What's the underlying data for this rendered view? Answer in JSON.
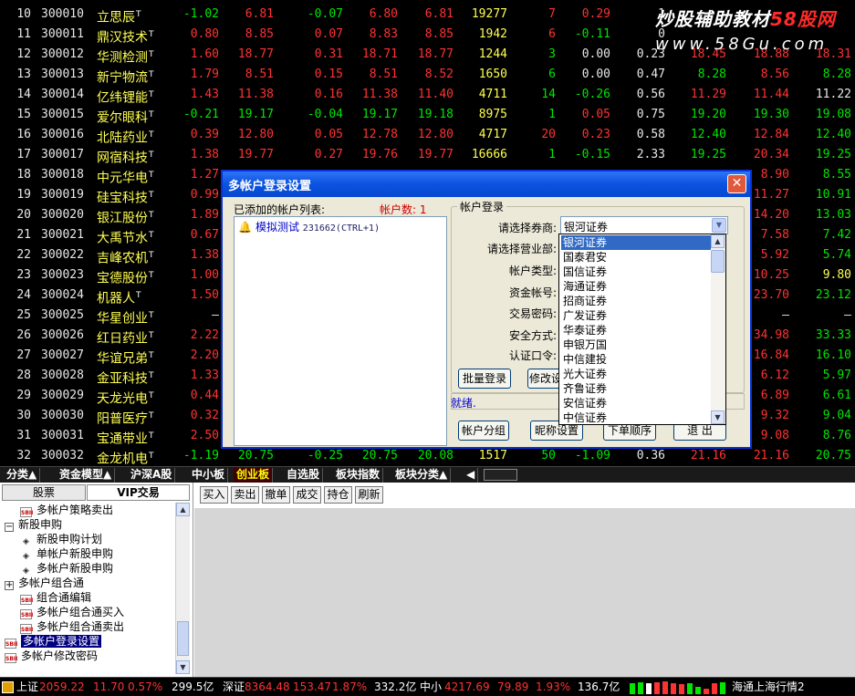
{
  "stock_rows": [
    {
      "idx": "10",
      "code": "300010",
      "name": "立思辰",
      "v": [
        "-1.02",
        "6.81",
        "-0.07",
        "6.80",
        "6.81",
        "19277",
        "7",
        "0.29",
        "1",
        "",
        "",
        ""
      ],
      "cls": [
        "green",
        "red",
        "green",
        "red",
        "red",
        "yellow",
        "red",
        "red",
        "white",
        "red",
        "red",
        "red"
      ]
    },
    {
      "idx": "11",
      "code": "300011",
      "name": "鼎汉技术",
      "v": [
        "0.80",
        "8.85",
        "0.07",
        "8.83",
        "8.85",
        "1942",
        "6",
        "-0.11",
        "0",
        "",
        "",
        ""
      ],
      "cls": [
        "red",
        "red",
        "red",
        "red",
        "red",
        "yellow",
        "red",
        "green",
        "white",
        "red",
        "red",
        "red"
      ]
    },
    {
      "idx": "12",
      "code": "300012",
      "name": "华测检测",
      "v": [
        "1.60",
        "18.77",
        "0.31",
        "18.71",
        "18.77",
        "1244",
        "3",
        "0.00",
        "0.23",
        "18.45",
        "18.88",
        "18.31"
      ],
      "cls": [
        "red",
        "red",
        "red",
        "red",
        "red",
        "yellow",
        "green",
        "white",
        "white",
        "red",
        "red",
        "red"
      ]
    },
    {
      "idx": "13",
      "code": "300013",
      "name": "新宁物流",
      "v": [
        "1.79",
        "8.51",
        "0.15",
        "8.51",
        "8.52",
        "1650",
        "6",
        "0.00",
        "0.47",
        "8.28",
        "8.56",
        "8.28"
      ],
      "cls": [
        "red",
        "red",
        "red",
        "red",
        "red",
        "yellow",
        "green",
        "white",
        "white",
        "green",
        "red",
        "green"
      ]
    },
    {
      "idx": "14",
      "code": "300014",
      "name": "亿纬锂能",
      "v": [
        "1.43",
        "11.38",
        "0.16",
        "11.38",
        "11.40",
        "4711",
        "14",
        "-0.26",
        "0.56",
        "11.29",
        "11.44",
        "11.22"
      ],
      "cls": [
        "red",
        "red",
        "red",
        "red",
        "red",
        "yellow",
        "green",
        "green",
        "white",
        "red",
        "red",
        "white"
      ]
    },
    {
      "idx": "15",
      "code": "300015",
      "name": "爱尔眼科",
      "v": [
        "-0.21",
        "19.17",
        "-0.04",
        "19.17",
        "19.18",
        "8975",
        "1",
        "0.05",
        "0.75",
        "19.20",
        "19.30",
        "19.08"
      ],
      "cls": [
        "green",
        "green",
        "green",
        "green",
        "green",
        "yellow",
        "green",
        "red",
        "white",
        "green",
        "green",
        "green"
      ]
    },
    {
      "idx": "16",
      "code": "300016",
      "name": "北陆药业",
      "v": [
        "0.39",
        "12.80",
        "0.05",
        "12.78",
        "12.80",
        "4717",
        "20",
        "0.23",
        "0.58",
        "12.40",
        "12.84",
        "12.40"
      ],
      "cls": [
        "red",
        "red",
        "red",
        "red",
        "red",
        "yellow",
        "red",
        "red",
        "white",
        "green",
        "red",
        "green"
      ]
    },
    {
      "idx": "17",
      "code": "300017",
      "name": "网宿科技",
      "v": [
        "1.38",
        "19.77",
        "0.27",
        "19.76",
        "19.77",
        "16666",
        "1",
        "-0.15",
        "2.33",
        "19.25",
        "20.34",
        "19.25"
      ],
      "cls": [
        "red",
        "red",
        "red",
        "red",
        "red",
        "yellow",
        "green",
        "green",
        "white",
        "green",
        "red",
        "green"
      ]
    },
    {
      "idx": "18",
      "code": "300018",
      "name": "中元华电",
      "v": [
        "1.27",
        "",
        "",
        "",
        "",
        "",
        "",
        "",
        "",
        "",
        "8.90",
        "8.55"
      ],
      "cls": [
        "red",
        "red",
        "red",
        "red",
        "red",
        "yellow",
        "red",
        "red",
        "white",
        "red",
        "red",
        "green"
      ]
    },
    {
      "idx": "19",
      "code": "300019",
      "name": "硅宝科技",
      "v": [
        "0.99",
        "",
        "",
        "",
        "",
        "",
        "",
        "",
        "",
        "",
        "11.27",
        "10.91"
      ],
      "cls": [
        "red",
        "red",
        "red",
        "red",
        "red",
        "yellow",
        "red",
        "red",
        "white",
        "red",
        "red",
        "green"
      ]
    },
    {
      "idx": "20",
      "code": "300020",
      "name": "银江股份",
      "v": [
        "1.89",
        "",
        "",
        "",
        "",
        "",
        "",
        "",
        "",
        "",
        "14.20",
        "13.03"
      ],
      "cls": [
        "red",
        "red",
        "red",
        "red",
        "red",
        "yellow",
        "red",
        "red",
        "white",
        "red",
        "red",
        "green"
      ]
    },
    {
      "idx": "21",
      "code": "300021",
      "name": "大禹节水",
      "v": [
        "0.67",
        "",
        "",
        "",
        "",
        "",
        "",
        "",
        "",
        "",
        "7.58",
        "7.42"
      ],
      "cls": [
        "red",
        "red",
        "red",
        "red",
        "red",
        "yellow",
        "red",
        "red",
        "white",
        "red",
        "red",
        "green"
      ]
    },
    {
      "idx": "22",
      "code": "300022",
      "name": "吉峰农机",
      "v": [
        "1.38",
        "",
        "",
        "",
        "",
        "",
        "",
        "",
        "",
        "",
        "5.92",
        "5.74"
      ],
      "cls": [
        "red",
        "red",
        "red",
        "red",
        "red",
        "yellow",
        "red",
        "red",
        "white",
        "red",
        "red",
        "green"
      ]
    },
    {
      "idx": "23",
      "code": "300023",
      "name": "宝德股份",
      "v": [
        "1.00",
        "",
        "",
        "",
        "",
        "",
        "",
        "",
        "",
        "",
        "10.25",
        "9.80"
      ],
      "cls": [
        "red",
        "red",
        "red",
        "red",
        "red",
        "yellow",
        "red",
        "red",
        "white",
        "red",
        "red",
        "yellow"
      ]
    },
    {
      "idx": "24",
      "code": "300024",
      "name": "机器人",
      "v": [
        "1.50",
        "",
        "",
        "",
        "",
        "",
        "",
        "",
        "",
        "",
        "23.70",
        "23.12"
      ],
      "cls": [
        "red",
        "red",
        "red",
        "red",
        "red",
        "yellow",
        "red",
        "red",
        "white",
        "red",
        "red",
        "green"
      ]
    },
    {
      "idx": "25",
      "code": "300025",
      "name": "华星创业",
      "v": [
        "–",
        "",
        "",
        "",
        "",
        "",
        "",
        "",
        "",
        "",
        "–",
        "–"
      ],
      "cls": [
        "white",
        "red",
        "red",
        "red",
        "red",
        "yellow",
        "red",
        "red",
        "white",
        "red",
        "white",
        "white"
      ]
    },
    {
      "idx": "26",
      "code": "300026",
      "name": "红日药业",
      "v": [
        "2.22",
        "",
        "",
        "",
        "",
        "",
        "",
        "",
        "",
        "",
        "34.98",
        "33.33"
      ],
      "cls": [
        "red",
        "red",
        "red",
        "red",
        "red",
        "yellow",
        "red",
        "red",
        "white",
        "red",
        "red",
        "green"
      ]
    },
    {
      "idx": "27",
      "code": "300027",
      "name": "华谊兄弟",
      "v": [
        "2.20",
        "",
        "",
        "",
        "",
        "",
        "",
        "",
        "",
        "",
        "16.84",
        "16.10"
      ],
      "cls": [
        "red",
        "red",
        "red",
        "red",
        "red",
        "yellow",
        "red",
        "red",
        "white",
        "red",
        "red",
        "green"
      ]
    },
    {
      "idx": "28",
      "code": "300028",
      "name": "金亚科技",
      "v": [
        "1.33",
        "",
        "",
        "",
        "",
        "",
        "",
        "",
        "",
        "",
        "6.12",
        "5.97"
      ],
      "cls": [
        "red",
        "red",
        "red",
        "red",
        "red",
        "yellow",
        "red",
        "red",
        "white",
        "red",
        "red",
        "green"
      ]
    },
    {
      "idx": "29",
      "code": "300029",
      "name": "天龙光电",
      "v": [
        "0.44",
        "",
        "",
        "",
        "",
        "",
        "",
        "",
        "",
        "",
        "6.89",
        "6.61"
      ],
      "cls": [
        "red",
        "red",
        "red",
        "red",
        "red",
        "yellow",
        "red",
        "red",
        "white",
        "red",
        "red",
        "green"
      ]
    },
    {
      "idx": "30",
      "code": "300030",
      "name": "阳普医疗",
      "v": [
        "0.32",
        "",
        "",
        "",
        "",
        "",
        "",
        "",
        "",
        "",
        "9.32",
        "9.04"
      ],
      "cls": [
        "red",
        "red",
        "red",
        "red",
        "red",
        "yellow",
        "red",
        "red",
        "white",
        "red",
        "red",
        "green"
      ]
    },
    {
      "idx": "31",
      "code": "300031",
      "name": "宝通带业",
      "v": [
        "2.50",
        "",
        "",
        "",
        "",
        "",
        "",
        "",
        "",
        "",
        "9.08",
        "8.76"
      ],
      "cls": [
        "red",
        "red",
        "red",
        "red",
        "red",
        "yellow",
        "red",
        "red",
        "white",
        "red",
        "red",
        "green"
      ]
    },
    {
      "idx": "32",
      "code": "300032",
      "name": "金龙机电",
      "v": [
        "-1.19",
        "20.75",
        "-0.25",
        "20.75",
        "20.08",
        "1517",
        "50",
        "-1.09",
        "0.36",
        "21.16",
        "21.16",
        "20.75"
      ],
      "cls": [
        "green",
        "green",
        "green",
        "green",
        "green",
        "yellow",
        "green",
        "green",
        "white",
        "red",
        "red",
        "green"
      ]
    }
  ],
  "stock_name_mark": "T",
  "watermark": {
    "title_a": "炒股辅助教材",
    "title_b": "58股网",
    "url": "www.58Gu.com"
  },
  "tabs": [
    {
      "label": "分类▲",
      "active": false
    },
    {
      "label": "资金模型▲",
      "active": false
    },
    {
      "label": "沪深A股",
      "active": false
    },
    {
      "label": "中小板",
      "active": false
    },
    {
      "label": "创业板",
      "active": true
    },
    {
      "label": "自选股",
      "active": false
    },
    {
      "label": "板块指数",
      "active": false
    },
    {
      "label": "板块分类▲",
      "active": false
    },
    {
      "label": "◀",
      "active": false
    }
  ],
  "panel_tabs": [
    "股票",
    "VIP交易"
  ],
  "tree": [
    {
      "label": "多帐户策略卖出",
      "icon": "doc",
      "level": 1
    },
    {
      "label": "新股申购",
      "icon": "minus",
      "level": 0
    },
    {
      "label": "新股申购计划",
      "icon": "dia",
      "level": 1
    },
    {
      "label": "单帐户新股申购",
      "icon": "dia",
      "level": 1
    },
    {
      "label": "多帐户新股申购",
      "icon": "dia",
      "level": 1
    },
    {
      "label": "多帐户组合通",
      "icon": "plus",
      "level": 0
    },
    {
      "label": "组合通编辑",
      "icon": "doc",
      "level": 1
    },
    {
      "label": "多帐户组合通买入",
      "icon": "doc",
      "level": 1
    },
    {
      "label": "多帐户组合通卖出",
      "icon": "doc",
      "level": 1
    },
    {
      "label": "多帐户登录设置",
      "icon": "doc",
      "level": 0,
      "selected": true
    },
    {
      "label": "多帐户修改密码",
      "icon": "doc",
      "level": 0
    }
  ],
  "toolbar": [
    "买入",
    "卖出",
    "撤单",
    "成交",
    "持仓",
    "刷新"
  ],
  "status": {
    "sh_label": "上证",
    "sh_value": "2059.22",
    "sh_change": "11.70",
    "sh_pct": "0.57%",
    "sh_amount": "299.5亿",
    "sz_label": "深证",
    "sz_value": "8364.48",
    "sz_change": "153.47",
    "sz_pct": "1.87%",
    "sz_amount": "332.2亿",
    "zx_label": "中小",
    "zx_value": "4217.69",
    "zx_change": "79.89",
    "zx_pct": "1.93%",
    "zx_amount": "136.7亿",
    "server": "海通上海行情2"
  },
  "dialog": {
    "title": "多帐户登录设置",
    "close": "✕",
    "list_label": "已添加的帐户列表:",
    "count_label": "帐户数: 1",
    "account_name": "模拟测试",
    "account_code": "231662(CTRL+1)",
    "group_title": "帐户登录",
    "fields": [
      "请选择券商:",
      "请选择营业部:",
      "帐户类型:",
      "资金帐号:",
      "交易密码:",
      "安全方式:",
      "认证口令:"
    ],
    "broker_value": "银河证券",
    "btn_batch_login": "批量登录",
    "btn_modify": "修改设",
    "ready": "就绪.",
    "btn_group": "帐户分组",
    "btn_nickname": "昵称设置",
    "btn_order": "下单顺序",
    "btn_exit": "退 出"
  },
  "broker_options": [
    "银河证券",
    "国泰君安",
    "国信证券",
    "海通证券",
    "招商证券",
    "广发证券",
    "华泰证券",
    "申银万国",
    "中信建投",
    "光大证券",
    "齐鲁证券",
    "安信证券",
    "中信证券"
  ],
  "colors": {
    "up": "#ff3232",
    "down": "#00e600",
    "name": "#ffff54",
    "dialog_title": "#0a52e0",
    "selection": "#316ac5"
  }
}
